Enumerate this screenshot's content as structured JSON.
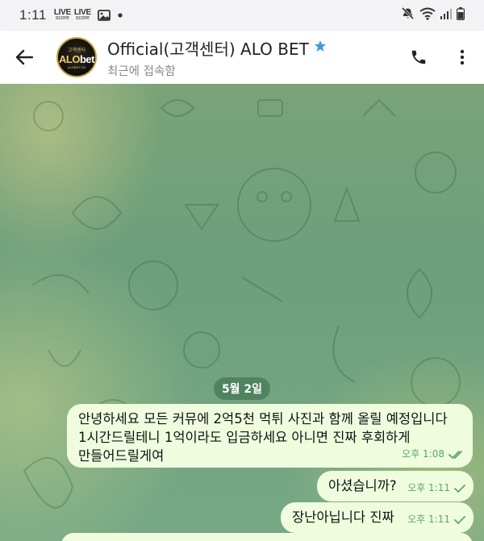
{
  "status_bar": {
    "time": "1:11",
    "badge1_title": "LIVE",
    "badge1_sub": "score",
    "badge2_title": "LIVE",
    "badge2_sub": "score",
    "icons": [
      "gallery-icon",
      "dot-icon",
      "mute-icon",
      "wifi-icon",
      "signal-icon",
      "battery-icon"
    ]
  },
  "header": {
    "title": "Official(고객센터) ALO BET",
    "status": "최근에 접속함",
    "avatar": {
      "top": "고객센터",
      "main_prefix": "ALO",
      "main_suffix": "bet",
      "sub": "ALOBET.VN"
    },
    "verified_color": "#3d9be0"
  },
  "chat": {
    "date": "5월 2일",
    "messages": [
      {
        "lines": [
          "안녕하세요 모든 커뮤에 2억5천 먹튀 사진과 함께 올릴 예정입니다",
          "1시간드릴테니 1억이라도 입금하세요 아니면 진짜 후회하게",
          "만들어드릴게여"
        ],
        "time": "오후 1:08",
        "status": "read"
      },
      {
        "lines": [
          "아셨습니까?"
        ],
        "time": "오후 1:11",
        "status": "sent"
      },
      {
        "lines": [
          "장난아닙니다 진짜"
        ],
        "time": "오후 1:11",
        "status": "sent"
      }
    ]
  },
  "colors": {
    "bubble_out": "#effdde",
    "check_green": "#5aaa61",
    "bg_green": "#6fa07a"
  }
}
